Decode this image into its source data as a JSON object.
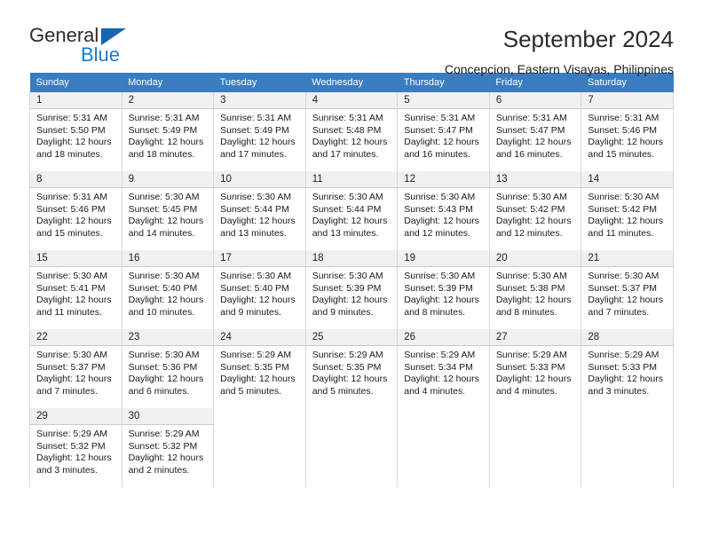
{
  "logo": {
    "primary_text": "General",
    "secondary_text": "Blue",
    "triangle_icon": "triangle-icon",
    "primary_color": "#2b2b2b",
    "secondary_color": "#1b79c8"
  },
  "header": {
    "title": "September 2024",
    "subtitle": "Concepcion, Eastern Visayas, Philippines"
  },
  "theme": {
    "header_bg": "#3a7cc0",
    "daynum_bg": "#f0f0f0",
    "grid_line": "#d8d8d8"
  },
  "weekdays": [
    "Sunday",
    "Monday",
    "Tuesday",
    "Wednesday",
    "Thursday",
    "Friday",
    "Saturday"
  ],
  "weeks": [
    [
      {
        "day": "1",
        "sunrise": "Sunrise: 5:31 AM",
        "sunset": "Sunset: 5:50 PM",
        "daylight_line1": "Daylight: 12 hours",
        "daylight_line2": "and 18 minutes."
      },
      {
        "day": "2",
        "sunrise": "Sunrise: 5:31 AM",
        "sunset": "Sunset: 5:49 PM",
        "daylight_line1": "Daylight: 12 hours",
        "daylight_line2": "and 18 minutes."
      },
      {
        "day": "3",
        "sunrise": "Sunrise: 5:31 AM",
        "sunset": "Sunset: 5:49 PM",
        "daylight_line1": "Daylight: 12 hours",
        "daylight_line2": "and 17 minutes."
      },
      {
        "day": "4",
        "sunrise": "Sunrise: 5:31 AM",
        "sunset": "Sunset: 5:48 PM",
        "daylight_line1": "Daylight: 12 hours",
        "daylight_line2": "and 17 minutes."
      },
      {
        "day": "5",
        "sunrise": "Sunrise: 5:31 AM",
        "sunset": "Sunset: 5:47 PM",
        "daylight_line1": "Daylight: 12 hours",
        "daylight_line2": "and 16 minutes."
      },
      {
        "day": "6",
        "sunrise": "Sunrise: 5:31 AM",
        "sunset": "Sunset: 5:47 PM",
        "daylight_line1": "Daylight: 12 hours",
        "daylight_line2": "and 16 minutes."
      },
      {
        "day": "7",
        "sunrise": "Sunrise: 5:31 AM",
        "sunset": "Sunset: 5:46 PM",
        "daylight_line1": "Daylight: 12 hours",
        "daylight_line2": "and 15 minutes."
      }
    ],
    [
      {
        "day": "8",
        "sunrise": "Sunrise: 5:31 AM",
        "sunset": "Sunset: 5:46 PM",
        "daylight_line1": "Daylight: 12 hours",
        "daylight_line2": "and 15 minutes."
      },
      {
        "day": "9",
        "sunrise": "Sunrise: 5:30 AM",
        "sunset": "Sunset: 5:45 PM",
        "daylight_line1": "Daylight: 12 hours",
        "daylight_line2": "and 14 minutes."
      },
      {
        "day": "10",
        "sunrise": "Sunrise: 5:30 AM",
        "sunset": "Sunset: 5:44 PM",
        "daylight_line1": "Daylight: 12 hours",
        "daylight_line2": "and 13 minutes."
      },
      {
        "day": "11",
        "sunrise": "Sunrise: 5:30 AM",
        "sunset": "Sunset: 5:44 PM",
        "daylight_line1": "Daylight: 12 hours",
        "daylight_line2": "and 13 minutes."
      },
      {
        "day": "12",
        "sunrise": "Sunrise: 5:30 AM",
        "sunset": "Sunset: 5:43 PM",
        "daylight_line1": "Daylight: 12 hours",
        "daylight_line2": "and 12 minutes."
      },
      {
        "day": "13",
        "sunrise": "Sunrise: 5:30 AM",
        "sunset": "Sunset: 5:42 PM",
        "daylight_line1": "Daylight: 12 hours",
        "daylight_line2": "and 12 minutes."
      },
      {
        "day": "14",
        "sunrise": "Sunrise: 5:30 AM",
        "sunset": "Sunset: 5:42 PM",
        "daylight_line1": "Daylight: 12 hours",
        "daylight_line2": "and 11 minutes."
      }
    ],
    [
      {
        "day": "15",
        "sunrise": "Sunrise: 5:30 AM",
        "sunset": "Sunset: 5:41 PM",
        "daylight_line1": "Daylight: 12 hours",
        "daylight_line2": "and 11 minutes."
      },
      {
        "day": "16",
        "sunrise": "Sunrise: 5:30 AM",
        "sunset": "Sunset: 5:40 PM",
        "daylight_line1": "Daylight: 12 hours",
        "daylight_line2": "and 10 minutes."
      },
      {
        "day": "17",
        "sunrise": "Sunrise: 5:30 AM",
        "sunset": "Sunset: 5:40 PM",
        "daylight_line1": "Daylight: 12 hours",
        "daylight_line2": "and 9 minutes."
      },
      {
        "day": "18",
        "sunrise": "Sunrise: 5:30 AM",
        "sunset": "Sunset: 5:39 PM",
        "daylight_line1": "Daylight: 12 hours",
        "daylight_line2": "and 9 minutes."
      },
      {
        "day": "19",
        "sunrise": "Sunrise: 5:30 AM",
        "sunset": "Sunset: 5:39 PM",
        "daylight_line1": "Daylight: 12 hours",
        "daylight_line2": "and 8 minutes."
      },
      {
        "day": "20",
        "sunrise": "Sunrise: 5:30 AM",
        "sunset": "Sunset: 5:38 PM",
        "daylight_line1": "Daylight: 12 hours",
        "daylight_line2": "and 8 minutes."
      },
      {
        "day": "21",
        "sunrise": "Sunrise: 5:30 AM",
        "sunset": "Sunset: 5:37 PM",
        "daylight_line1": "Daylight: 12 hours",
        "daylight_line2": "and 7 minutes."
      }
    ],
    [
      {
        "day": "22",
        "sunrise": "Sunrise: 5:30 AM",
        "sunset": "Sunset: 5:37 PM",
        "daylight_line1": "Daylight: 12 hours",
        "daylight_line2": "and 7 minutes."
      },
      {
        "day": "23",
        "sunrise": "Sunrise: 5:30 AM",
        "sunset": "Sunset: 5:36 PM",
        "daylight_line1": "Daylight: 12 hours",
        "daylight_line2": "and 6 minutes."
      },
      {
        "day": "24",
        "sunrise": "Sunrise: 5:29 AM",
        "sunset": "Sunset: 5:35 PM",
        "daylight_line1": "Daylight: 12 hours",
        "daylight_line2": "and 5 minutes."
      },
      {
        "day": "25",
        "sunrise": "Sunrise: 5:29 AM",
        "sunset": "Sunset: 5:35 PM",
        "daylight_line1": "Daylight: 12 hours",
        "daylight_line2": "and 5 minutes."
      },
      {
        "day": "26",
        "sunrise": "Sunrise: 5:29 AM",
        "sunset": "Sunset: 5:34 PM",
        "daylight_line1": "Daylight: 12 hours",
        "daylight_line2": "and 4 minutes."
      },
      {
        "day": "27",
        "sunrise": "Sunrise: 5:29 AM",
        "sunset": "Sunset: 5:33 PM",
        "daylight_line1": "Daylight: 12 hours",
        "daylight_line2": "and 4 minutes."
      },
      {
        "day": "28",
        "sunrise": "Sunrise: 5:29 AM",
        "sunset": "Sunset: 5:33 PM",
        "daylight_line1": "Daylight: 12 hours",
        "daylight_line2": "and 3 minutes."
      }
    ],
    [
      {
        "day": "29",
        "sunrise": "Sunrise: 5:29 AM",
        "sunset": "Sunset: 5:32 PM",
        "daylight_line1": "Daylight: 12 hours",
        "daylight_line2": "and 3 minutes."
      },
      {
        "day": "30",
        "sunrise": "Sunrise: 5:29 AM",
        "sunset": "Sunset: 5:32 PM",
        "daylight_line1": "Daylight: 12 hours",
        "daylight_line2": "and 2 minutes."
      },
      {
        "day": "",
        "sunrise": "",
        "sunset": "",
        "daylight_line1": "",
        "daylight_line2": ""
      },
      {
        "day": "",
        "sunrise": "",
        "sunset": "",
        "daylight_line1": "",
        "daylight_line2": ""
      },
      {
        "day": "",
        "sunrise": "",
        "sunset": "",
        "daylight_line1": "",
        "daylight_line2": ""
      },
      {
        "day": "",
        "sunrise": "",
        "sunset": "",
        "daylight_line1": "",
        "daylight_line2": ""
      },
      {
        "day": "",
        "sunrise": "",
        "sunset": "",
        "daylight_line1": "",
        "daylight_line2": ""
      }
    ]
  ]
}
